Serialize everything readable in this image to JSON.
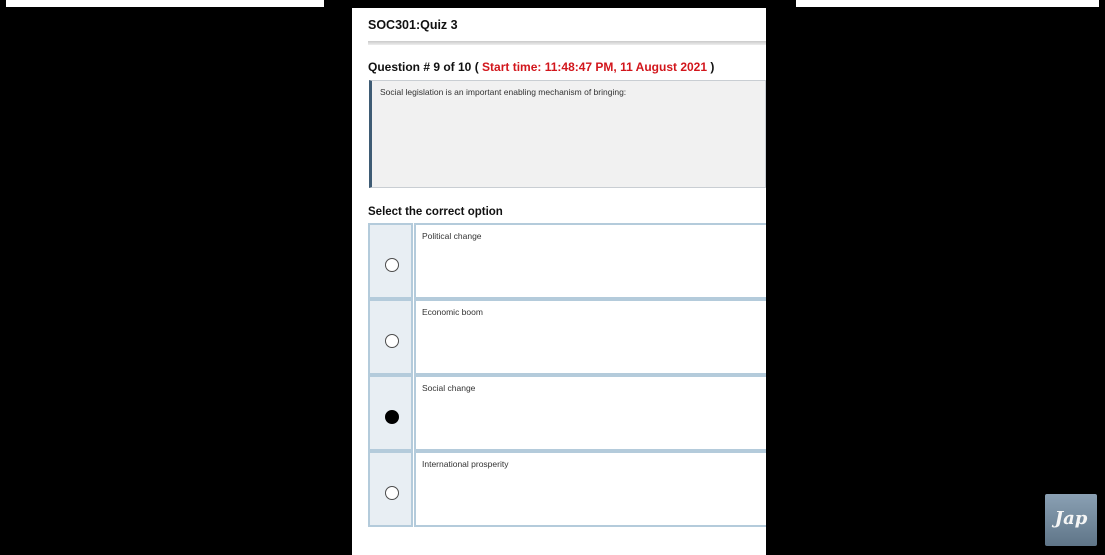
{
  "quiz": {
    "title": "SOC301:Quiz 3"
  },
  "question": {
    "header_prefix": "Question # 9 of 10 ( ",
    "start_time": "Start time: 11:48:47 PM, 11 August 2021",
    "header_suffix": " )",
    "text": "Social legislation is an important enabling mechanism of bringing:"
  },
  "select_label": "Select the correct option",
  "options": [
    {
      "label": "Political change",
      "selected": false
    },
    {
      "label": "Economic boom",
      "selected": false
    },
    {
      "label": "Social change",
      "selected": true
    },
    {
      "label": "International prosperity",
      "selected": false
    }
  ],
  "watermark": {
    "text": "Jap"
  },
  "colors": {
    "accent_red": "#d2161c",
    "option_border": "#b4cbdb",
    "question_border": "#3e5b74"
  }
}
